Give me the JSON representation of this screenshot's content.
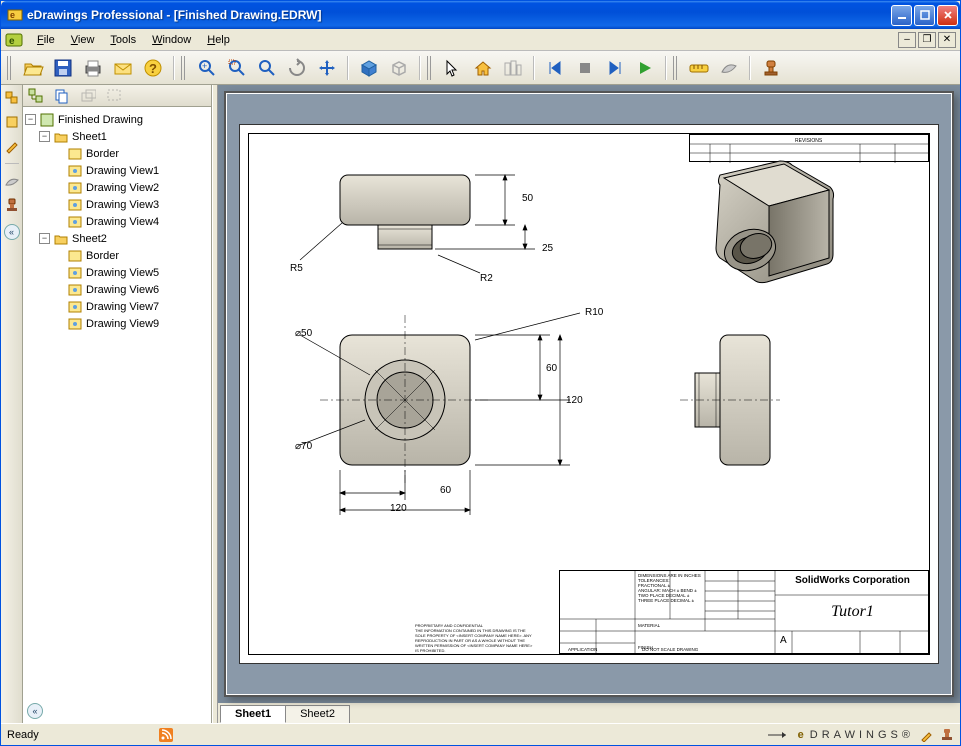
{
  "title": "eDrawings Professional - [Finished Drawing.EDRW]",
  "menus": {
    "file": "File",
    "view": "View",
    "tools": "Tools",
    "window": "Window",
    "help": "Help"
  },
  "tree": {
    "root": "Finished Drawing",
    "sheet1": "Sheet1",
    "sheet2": "Sheet2",
    "items1": [
      "Border",
      "Drawing View1",
      "Drawing View2",
      "Drawing View3",
      "Drawing View4"
    ],
    "items2": [
      "Border",
      "Drawing View5",
      "Drawing View6",
      "Drawing View7",
      "Drawing View9"
    ]
  },
  "drawing": {
    "dims": {
      "d50": "50",
      "d25": "25",
      "r5": "R5",
      "r2": "R2",
      "dia50": "⌀50",
      "dia70": "⌀70",
      "d60a": "60",
      "d120a": "120",
      "d60b": "60",
      "d120b": "120",
      "r10": "R10"
    },
    "titleblock": {
      "company": "SolidWorks Corporation",
      "partname": "Tutor1",
      "size": "A",
      "revisions": "REVISIONS",
      "dim_note": "DIMENSIONS ARE IN INCHES",
      "tol": "TOLERANCES:",
      "frac": "FRACTIONAL ±",
      "ang": "ANGULAR: MACH ±   BEND ±",
      "dec2": "TWO PLACE DECIMAL ±",
      "dec3": "THREE PLACE DECIMAL ±",
      "app": "APPLICATION",
      "noscale": "DO NOT SCALE DRAWING"
    }
  },
  "sheets": {
    "s1": "Sheet1",
    "s2": "Sheet2"
  },
  "status": {
    "ready": "Ready",
    "brand": "DRAWINGS®"
  }
}
